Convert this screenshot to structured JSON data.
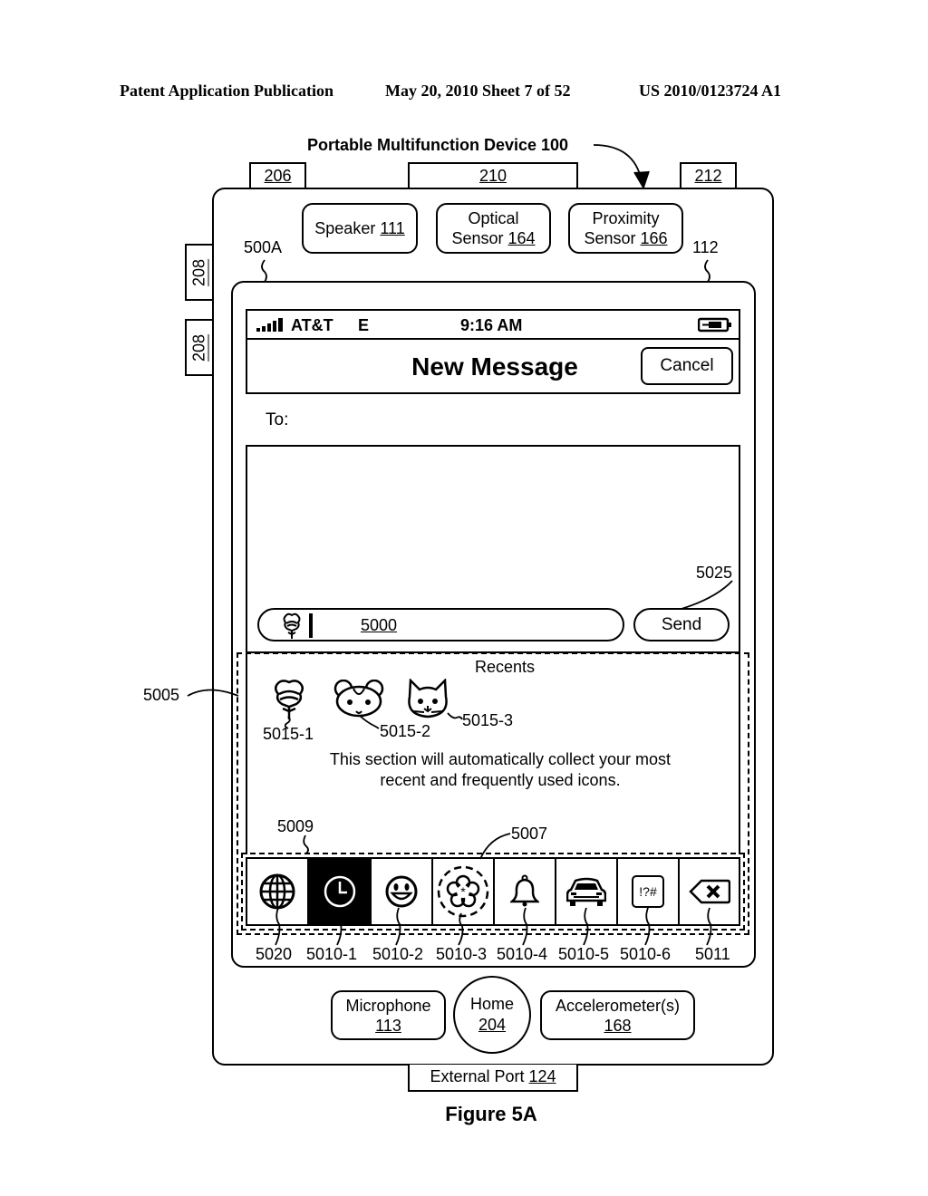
{
  "header": {
    "publication": "Patent Application Publication",
    "date_sheet": "May 20, 2010  Sheet 7 of 52",
    "patent_number": "US 2010/0123724 A1"
  },
  "device": {
    "title": "Portable Multifunction Device 100",
    "top_buttons": [
      "206",
      "210",
      "212"
    ],
    "side_buttons": [
      "208",
      "208"
    ],
    "screen_ref": "500A",
    "display_ref": "112",
    "speaker": {
      "label": "Speaker",
      "ref": "111"
    },
    "optical_sensor": {
      "line1": "Optical",
      "label": "Sensor",
      "ref": "164"
    },
    "proximity_sensor": {
      "line1": "Proximity",
      "label": "Sensor",
      "ref": "166"
    },
    "microphone": {
      "label": "Microphone",
      "ref": "113"
    },
    "home": {
      "label": "Home",
      "ref": "204"
    },
    "accelerometer": {
      "label": "Accelerometer(s)",
      "ref": "168"
    },
    "external_port": {
      "label": "External Port",
      "ref": "124"
    }
  },
  "status_bar": {
    "carrier": "AT&T",
    "network": "E",
    "time": "9:16 AM",
    "signal_icon": "signal-bars-icon",
    "battery_icon": "battery-charging-icon"
  },
  "nav_bar": {
    "title": "New Message",
    "cancel_label": "Cancel"
  },
  "compose": {
    "to_label": "To:",
    "input_ref": "5000",
    "input_icon": "rose-icon",
    "send_label": "Send",
    "send_ref": "5025"
  },
  "emoji_keyboard": {
    "ref": "5005",
    "section_title": "Recents",
    "recents": [
      {
        "icon": "rose-icon",
        "ref": "5015-1"
      },
      {
        "icon": "hamster-icon",
        "ref": "5015-2"
      },
      {
        "icon": "cat-icon",
        "ref": "5015-3"
      }
    ],
    "message_line1": "This section will automatically collect your most",
    "message_line2": "recent and frequently used icons.",
    "page_area_ref": "5009",
    "highlight_ref": "5007",
    "toolbar": [
      {
        "icon": "globe-icon",
        "ref": "5020",
        "selected": false
      },
      {
        "icon": "clock-icon",
        "ref": "5010-1",
        "selected": true
      },
      {
        "icon": "smiley-icon",
        "ref": "5010-2",
        "selected": false
      },
      {
        "icon": "flower-icon",
        "ref": "5010-3",
        "selected": false
      },
      {
        "icon": "bell-icon",
        "ref": "5010-4",
        "selected": false
      },
      {
        "icon": "car-icon",
        "ref": "5010-5",
        "selected": false
      },
      {
        "icon": "symbols-icon",
        "ref": "5010-6",
        "selected": false,
        "text": "!?#"
      },
      {
        "icon": "backspace-icon",
        "ref": "5011",
        "selected": false
      }
    ]
  },
  "figure_caption": "Figure 5A"
}
